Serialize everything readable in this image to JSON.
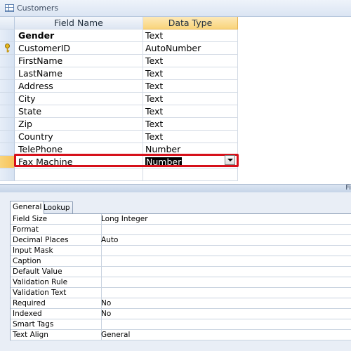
{
  "window": {
    "title": "Customers"
  },
  "grid": {
    "headers": {
      "field_name": "Field Name",
      "data_type": "Data Type"
    },
    "rows": [
      {
        "field": "Gender",
        "type": "Text",
        "bold": true
      },
      {
        "field": "CustomerID",
        "type": "AutoNumber",
        "primary_key": true
      },
      {
        "field": "FirstName",
        "type": "Text"
      },
      {
        "field": "LastName",
        "type": "Text"
      },
      {
        "field": "Address",
        "type": "Text"
      },
      {
        "field": "City",
        "type": "Text"
      },
      {
        "field": "State",
        "type": "Text"
      },
      {
        "field": "Zip",
        "type": "Text"
      },
      {
        "field": "Country",
        "type": "Text"
      },
      {
        "field": "TelePhone",
        "type": "Number"
      },
      {
        "field": "Fax Machine",
        "type": "Number",
        "selected": true
      }
    ]
  },
  "splitter": {
    "label": "Fi"
  },
  "properties": {
    "tabs": [
      {
        "label": "General",
        "active": true
      },
      {
        "label": "Lookup",
        "active": false
      }
    ],
    "rows": [
      {
        "name": "Field Size",
        "value": "Long Integer"
      },
      {
        "name": "Format",
        "value": ""
      },
      {
        "name": "Decimal Places",
        "value": "Auto"
      },
      {
        "name": "Input Mask",
        "value": ""
      },
      {
        "name": "Caption",
        "value": ""
      },
      {
        "name": "Default Value",
        "value": ""
      },
      {
        "name": "Validation Rule",
        "value": ""
      },
      {
        "name": "Validation Text",
        "value": ""
      },
      {
        "name": "Required",
        "value": "No"
      },
      {
        "name": "Indexed",
        "value": "No"
      },
      {
        "name": "Smart Tags",
        "value": ""
      },
      {
        "name": "Text Align",
        "value": "General"
      }
    ]
  },
  "colors": {
    "highlight_border": "#d6101a",
    "header_active": "#f9d47b"
  }
}
